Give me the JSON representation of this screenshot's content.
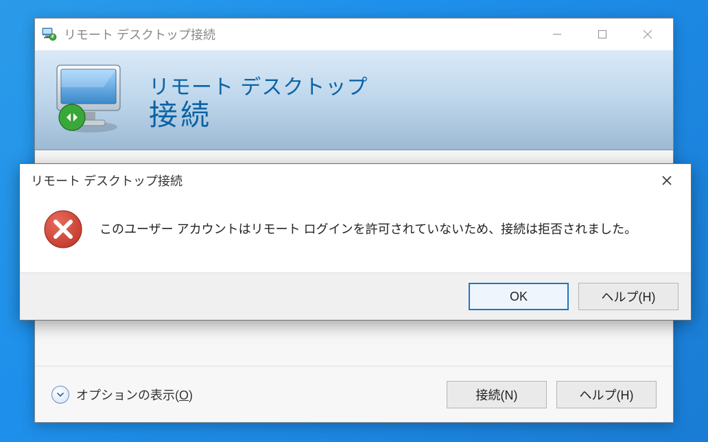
{
  "main_window": {
    "title": "リモート デスクトップ接続",
    "header_line1": "リモート デスクトップ",
    "header_line2": "接続",
    "options_label_pre": "オプションの表示(",
    "options_label_underline": "O",
    "options_label_post": ")",
    "connect_button": "接続(N)",
    "help_button": "ヘルプ(H)"
  },
  "dialog": {
    "title": "リモート デスクトップ接続",
    "message": "このユーザー アカウントはリモート ログインを許可されていないため、接続は拒否されました。",
    "ok_button": "OK",
    "help_button": "ヘルプ(H)"
  }
}
